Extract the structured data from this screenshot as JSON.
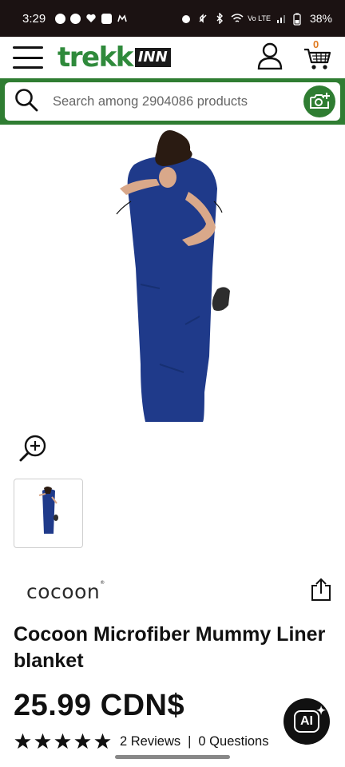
{
  "status_bar": {
    "time": "3:29",
    "battery": "38%",
    "network_label": "Vo LTE"
  },
  "header": {
    "logo_primary": "trekk",
    "logo_secondary": "INN",
    "cart_count": "0",
    "icons": [
      "menu-icon",
      "account-icon",
      "cart-icon"
    ]
  },
  "search": {
    "placeholder": "Search among 2904086 products",
    "icons": [
      "search-icon",
      "camera-search-icon"
    ]
  },
  "product": {
    "brand": "cocoon",
    "title": "Cocoon Microfiber Mummy Liner blanket",
    "price": "25.99 CDN$",
    "rating_stars": 5,
    "reviews": "2 Reviews",
    "separator": "|",
    "questions": "0 Questions"
  },
  "floating": {
    "ai_label": "AI"
  },
  "colors": {
    "brand_green": "#2f7d32",
    "logo_green": "#2f8a3b",
    "cart_badge": "#e07a1f",
    "status_bar_bg": "#1b1212",
    "liner_blue": "#1f3a8a"
  }
}
